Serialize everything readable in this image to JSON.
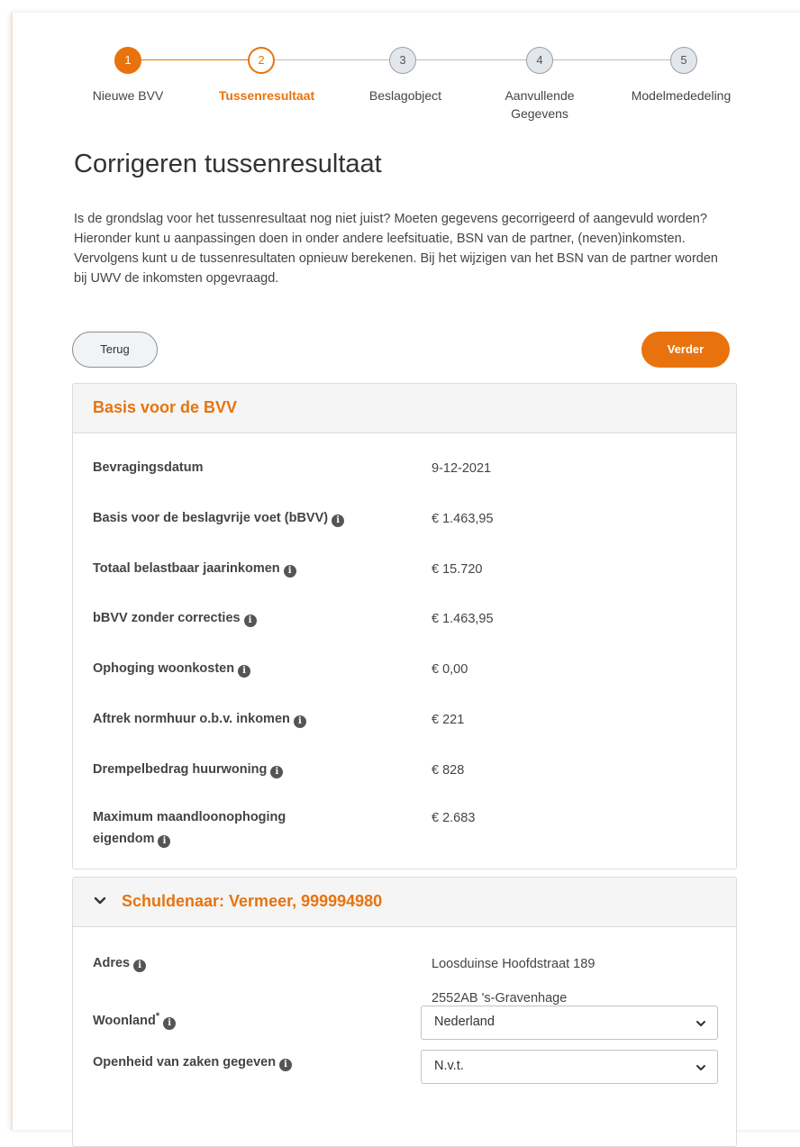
{
  "stepper": {
    "steps": [
      {
        "number": "1",
        "label": "Nieuwe BVV",
        "state": "done"
      },
      {
        "number": "2",
        "label": "Tussenresultaat",
        "state": "current"
      },
      {
        "number": "3",
        "label": "Beslagobject",
        "state": "pending"
      },
      {
        "number": "4",
        "label": "Aanvullende Gegevens",
        "state": "pending"
      },
      {
        "number": "5",
        "label": "Modelmededeling",
        "state": "pending"
      }
    ]
  },
  "page": {
    "title": "Corrigeren tussenresultaat",
    "intro": "Is de grondslag voor het tussenresultaat nog niet juist? Moeten gegevens gecorrigeerd of aangevuld worden? Hieronder kunt u aanpassingen doen in onder andere leefsituatie, BSN van de partner, (neven)inkomsten. Vervolgens kunt u de tussenresultaten opnieuw berekenen. Bij het wijzigen van het BSN van de partner worden bij UWV de inkomsten opgevraagd."
  },
  "actions": {
    "back_label": "Terug",
    "next_label": "Verder"
  },
  "basis_panel": {
    "title": "Basis voor de BVV",
    "rows": [
      {
        "label": "Bevragingsdatum",
        "value": "9-12-2021",
        "info": false
      },
      {
        "label": "Basis voor de beslagvrije voet (bBVV)",
        "value": "€ 1.463,95",
        "info": true
      },
      {
        "label": "Totaal belastbaar jaarinkomen",
        "value": "€ 15.720",
        "info": true
      },
      {
        "label": "bBVV zonder correcties",
        "value": "€ 1.463,95",
        "info": true
      },
      {
        "label": "Ophoging woonkosten",
        "value": "€ 0,00",
        "info": true
      },
      {
        "label": "Aftrek normhuur o.b.v. inkomen",
        "value": "€ 221",
        "info": true
      },
      {
        "label": "Drempelbedrag huurwoning",
        "value": "€ 828",
        "info": true
      },
      {
        "label_line1": "Maximum maandloonophoging",
        "label_line2": "eigendom",
        "value": "€ 2.683",
        "info": true
      }
    ]
  },
  "debtor_panel": {
    "title": "Schuldenaar: Vermeer, 999994980",
    "address_label": "Adres",
    "address_line1": "Loosduinse Hoofdstraat 189",
    "address_line2": "2552AB 's-Gravenhage",
    "country_label": "Woonland",
    "country_required_mark": "*",
    "country_value": "Nederland",
    "disclosure_label": "Openheid van zaken gegeven",
    "disclosure_value": "N.v.t."
  },
  "colors": {
    "accent": "#e8730e",
    "panel_header_bg": "#f5f5f5",
    "pending_step_bg": "#e3e6ea"
  }
}
